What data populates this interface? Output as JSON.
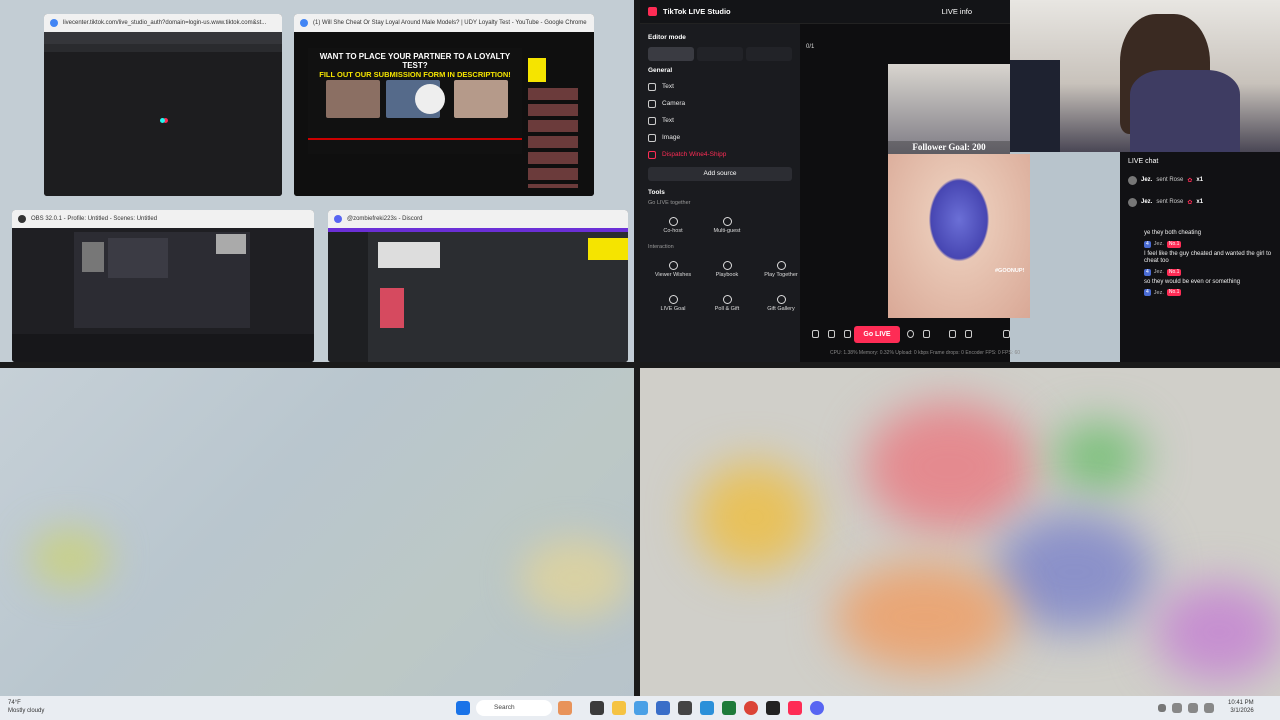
{
  "windows": {
    "chrome_tiktok": {
      "title": "livecenter.tiktok.com/live_studio_auth?domain=login-us.www.tiktok.com&st..."
    },
    "chrome_youtube": {
      "title": "(1) Will She Cheat Or Stay Loyal Around Male Models? | UDY Loyalty Test - YouTube - Google Chrome",
      "banner_line1": "WANT TO PLACE YOUR PARTNER TO A LOYALTY TEST?",
      "banner_line2": "FILL OUT OUR SUBMISSION FORM IN DESCRIPTION!"
    },
    "obs": {
      "title": "OBS 32.0.1 - Profile: Untitled - Scenes: Untitled"
    },
    "discord": {
      "title": "@zombiefreki223s - Discord"
    }
  },
  "tiktok_studio": {
    "app_title": "TikTok LIVE Studio",
    "live_info": "LIVE info",
    "editor_mode": "Editor mode",
    "general": "General",
    "sources": [
      "Text",
      "Camera",
      "Text",
      "Image",
      "Dispatch Wine4-Shipp"
    ],
    "add_source": "Add source",
    "tools": "Tools",
    "go_live_together": "Go LIVE together",
    "together_tools": [
      "Co-host",
      "Multi-guest"
    ],
    "interaction": "Interaction",
    "interaction_tools": [
      "Viewer Wishes",
      "Playbook",
      "Play Together",
      "LIVE Goal",
      "Poll & Gift",
      "Gift Gallery"
    ],
    "counter": "0/1",
    "follower_goal": "Follower Goal: 200",
    "gooning_tag": "#GOONUP!",
    "go_live": "Go LIVE",
    "stats": "CPU: 1.38%    Memory: 0.32%    Upload: 0 kbps    Frame drops: 0    Encoder FPS: 0    FPS: 60"
  },
  "chat": {
    "title": "LIVE chat",
    "gifts": [
      {
        "user": "Jez.",
        "text": "sent Rose",
        "count": "x1"
      },
      {
        "user": "Jez.",
        "text": "sent Rose",
        "count": "x1"
      }
    ],
    "messages": [
      {
        "text": "ye they both cheating",
        "badges": false
      },
      {
        "text": "I feel like the guy cheated and wanted the girl to cheat too",
        "badges": true,
        "user": "Jez.",
        "level": "4",
        "rank": "No.1"
      },
      {
        "text": "so they would be even or something",
        "badges": true,
        "user": "Jez.",
        "level": "4",
        "rank": "No.1"
      },
      {
        "text": "",
        "badges": true,
        "user": "Jez.",
        "level": "4",
        "rank": "No.1"
      }
    ]
  },
  "taskbar": {
    "weather_temp": "74°F",
    "weather_desc": "Mostly cloudy",
    "search": "Search",
    "time": "10:41 PM",
    "date": "3/1/2026"
  }
}
